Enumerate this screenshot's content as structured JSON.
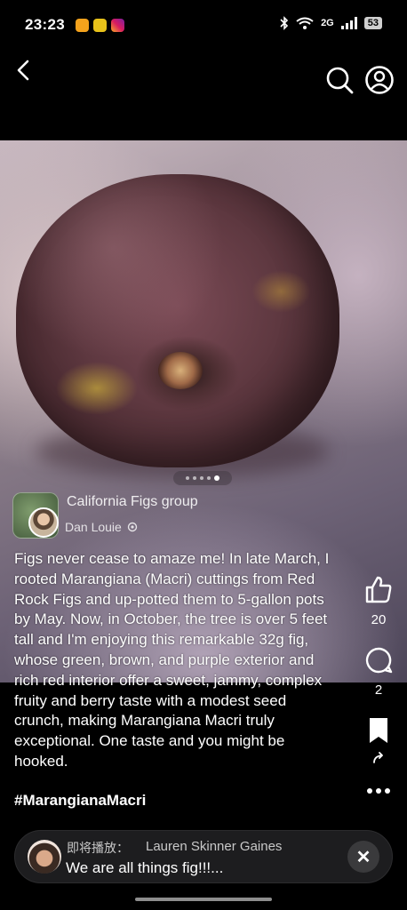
{
  "status_bar": {
    "time": "23:23",
    "network": "2G",
    "battery": "53",
    "app_icons": [
      {
        "name": "orange-app-icon",
        "color": "#f4a21c"
      },
      {
        "name": "yellow-app-icon",
        "color": "#e8c21a"
      },
      {
        "name": "instagram-icon",
        "color": "#c0308a"
      }
    ]
  },
  "post": {
    "group_name": "California Figs group",
    "author": "Dan Louie",
    "caption": "Figs never cease to amaze me! In late March, I rooted Marangiana (Macri) cuttings from Red Rock Figs and up-potted them to 5-gallon pots by May. Now, in October, the tree is over 5 feet tall and I'm enjoying this remarkable 32g fig, whose green, brown, and purple exterior and rich red interior offer a sweet, jammy, complex fruity and berry taste with a modest seed crunch, making Marangiana Macri truly exceptional.  One taste and you might be hooked.",
    "hashtag": "#MarangianaMacri",
    "carousel": {
      "total": 5,
      "current": 5
    }
  },
  "actions": {
    "likes": "20",
    "comments": "2"
  },
  "now_playing": {
    "label": "即将播放：",
    "name": "Lauren Skinner Gaines",
    "title": "We are all things fig!!!..."
  }
}
